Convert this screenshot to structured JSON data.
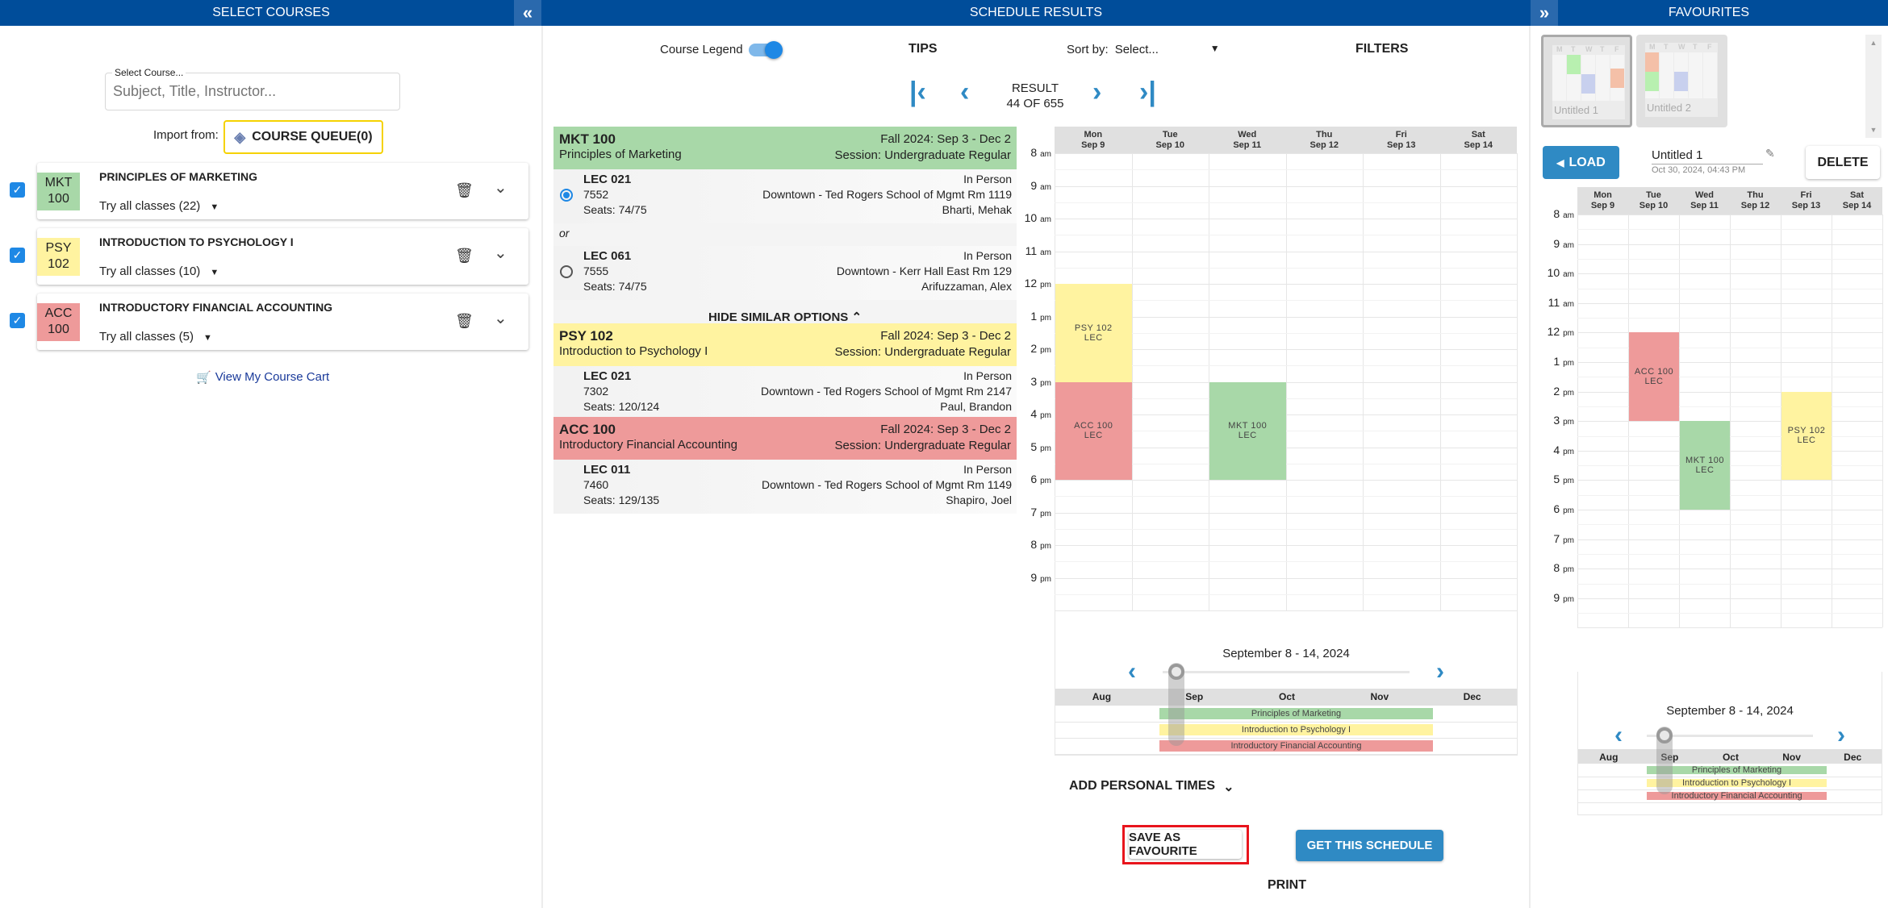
{
  "colors": {
    "header": "#004d9a",
    "accent": "#2f8ac4",
    "mkt": "#a8d8a8",
    "psy": "#fff3a0",
    "acc": "#ee9a9a",
    "highlight": "#e8141c"
  },
  "left": {
    "title": "SELECT COURSES",
    "collapse_icon": "«",
    "search": {
      "label": "Select Course...",
      "placeholder": "Subject, Title, Instructor..."
    },
    "import_label": "Import from:",
    "queue_label": "COURSE QUEUE(0)",
    "courses": [
      {
        "code1": "MKT",
        "code2": "100",
        "title": "PRINCIPLES OF MARKETING",
        "try": "Try all classes (22)",
        "color": "#a8d8a8"
      },
      {
        "code1": "PSY",
        "code2": "102",
        "title": "INTRODUCTION TO PSYCHOLOGY I",
        "try": "Try all classes (10)",
        "color": "#fff3a0"
      },
      {
        "code1": "ACC",
        "code2": "100",
        "title": "INTRODUCTORY FINANCIAL ACCOUNTING",
        "try": "Try all classes (5)",
        "color": "#ee9a9a"
      }
    ],
    "cart_label": "View My Course Cart"
  },
  "middle": {
    "title": "SCHEDULE RESULTS",
    "legend_label": "Course Legend",
    "tips": "TIPS",
    "sort_label": "Sort by:",
    "sort_value": "Select...",
    "filters": "FILTERS",
    "result_label": "RESULT",
    "result_count": "44 OF 655",
    "hide_similar": "HIDE SIMILAR OPTIONS",
    "or": "or",
    "sections": [
      {
        "code": "MKT 100",
        "name": "Principles of Marketing",
        "term": "Fall 2024: Sep 3 - Dec 2",
        "session": "Session: Undergraduate Regular",
        "color": "#a8d8a8",
        "options": [
          {
            "lec": "LEC 021",
            "id": "7552",
            "seats": "Seats: 74/75",
            "mode": "In Person",
            "loc": "Downtown - Ted Rogers School of Mgmt Rm 1119",
            "inst": "Bharti, Mehak",
            "selected": true
          },
          {
            "lec": "LEC 061",
            "id": "7555",
            "seats": "Seats: 74/75",
            "mode": "In Person",
            "loc": "Downtown - Kerr Hall East Rm 129",
            "inst": "Arifuzzaman, Alex",
            "selected": false
          }
        ]
      },
      {
        "code": "PSY 102",
        "name": "Introduction to Psychology I",
        "term": "Fall 2024: Sep 3 - Dec 2",
        "session": "Session: Undergraduate Regular",
        "color": "#fff3a0",
        "options": [
          {
            "lec": "LEC 021",
            "id": "7302",
            "seats": "Seats: 120/124",
            "mode": "In Person",
            "loc": "Downtown - Ted Rogers School of Mgmt Rm 2147",
            "inst": "Paul, Brandon"
          }
        ]
      },
      {
        "code": "ACC 100",
        "name": "Introductory Financial Accounting",
        "term": "Fall 2024: Sep 3 - Dec 2",
        "session": "Session: Undergraduate Regular",
        "color": "#ee9a9a",
        "options": [
          {
            "lec": "LEC 011",
            "id": "7460",
            "seats": "Seats: 129/135",
            "mode": "In Person",
            "loc": "Downtown - Ted Rogers School of Mgmt Rm 1149",
            "inst": "Shapiro, Joel"
          }
        ]
      }
    ],
    "calendar": {
      "days": [
        {
          "d": "Mon",
          "date": "Sep 9"
        },
        {
          "d": "Tue",
          "date": "Sep 10"
        },
        {
          "d": "Wed",
          "date": "Sep 11"
        },
        {
          "d": "Thu",
          "date": "Sep 12"
        },
        {
          "d": "Fri",
          "date": "Sep 13"
        },
        {
          "d": "Sat",
          "date": "Sep 14"
        }
      ],
      "hours": [
        {
          "n": "8",
          "s": "am"
        },
        {
          "n": "9",
          "s": "am"
        },
        {
          "n": "10",
          "s": "am"
        },
        {
          "n": "11",
          "s": "am"
        },
        {
          "n": "12",
          "s": "pm"
        },
        {
          "n": "1",
          "s": "pm"
        },
        {
          "n": "2",
          "s": "pm"
        },
        {
          "n": "3",
          "s": "pm"
        },
        {
          "n": "4",
          "s": "pm"
        },
        {
          "n": "5",
          "s": "pm"
        },
        {
          "n": "6",
          "s": "pm"
        },
        {
          "n": "7",
          "s": "pm"
        },
        {
          "n": "8",
          "s": "pm"
        },
        {
          "n": "9",
          "s": "pm"
        }
      ],
      "events": [
        {
          "day": 0,
          "start": 12,
          "end": 15,
          "code": "PSY 102",
          "type": "LEC",
          "color": "#fff3a0"
        },
        {
          "day": 0,
          "start": 15,
          "end": 18,
          "code": "ACC 100",
          "type": "LEC",
          "color": "#ee9a9a"
        },
        {
          "day": 2,
          "start": 15,
          "end": 18,
          "code": "MKT 100",
          "type": "LEC",
          "color": "#a8d8a8"
        }
      ]
    },
    "timeline": {
      "week": "September 8 - 14, 2024",
      "months": [
        "Aug",
        "Sep",
        "Oct",
        "Nov",
        "Dec"
      ],
      "bars": [
        {
          "label": "Principles of Marketing",
          "color": "#a8d8a8"
        },
        {
          "label": "Introduction to Psychology I",
          "color": "#fff3a0"
        },
        {
          "label": "Introductory Financial Accounting",
          "color": "#ee9a9a"
        }
      ]
    },
    "personal_times": "ADD PERSONAL TIMES",
    "save_favourite": "SAVE AS FAVOURITE",
    "get_schedule": "GET THIS SCHEDULE",
    "print": "PRINT"
  },
  "right": {
    "title": "FAVOURITES",
    "expand_icon": "»",
    "thumb_days": [
      "M",
      "T",
      "W",
      "T",
      "F"
    ],
    "favourites": [
      {
        "name": "Untitled 1"
      },
      {
        "name": "Untitled 2"
      }
    ],
    "load": "LOAD",
    "name_value": "Untitled 1",
    "saved_at": "Oct 30, 2024, 04:43 PM",
    "delete": "DELETE",
    "calendar": {
      "events": [
        {
          "day": 1,
          "start": 12,
          "end": 15,
          "code": "ACC 100",
          "type": "LEC",
          "color": "#ee9a9a"
        },
        {
          "day": 2,
          "start": 15,
          "end": 18,
          "code": "MKT 100",
          "type": "LEC",
          "color": "#a8d8a8"
        },
        {
          "day": 4,
          "start": 14,
          "end": 17,
          "code": "PSY 102",
          "type": "LEC",
          "color": "#fff3a0"
        }
      ]
    },
    "timeline": {
      "week": "September 8 - 14, 2024"
    }
  }
}
